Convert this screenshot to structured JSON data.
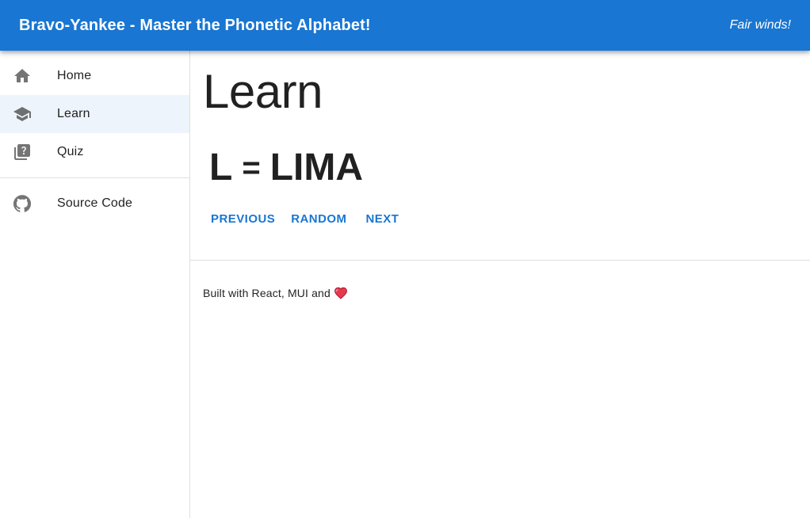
{
  "header": {
    "title": "Bravo-Yankee - Master the Phonetic Alphabet!",
    "tagline": "Fair winds!",
    "color": "#1976d2"
  },
  "sidebar": {
    "items": [
      {
        "label": "Home",
        "icon": "home-icon",
        "selected": false
      },
      {
        "label": "Learn",
        "icon": "school-icon",
        "selected": true
      },
      {
        "label": "Quiz",
        "icon": "quiz-icon",
        "selected": false
      }
    ],
    "source": {
      "label": "Source Code",
      "icon": "github-icon"
    }
  },
  "main": {
    "title": "Learn",
    "letter": "L",
    "equals": "=",
    "word": "LIMA",
    "buttons": {
      "previous": "Previous",
      "random": "Random",
      "next": "Next"
    }
  },
  "footer": {
    "text": "Built with React, MUI and",
    "icon": "heart-icon"
  }
}
